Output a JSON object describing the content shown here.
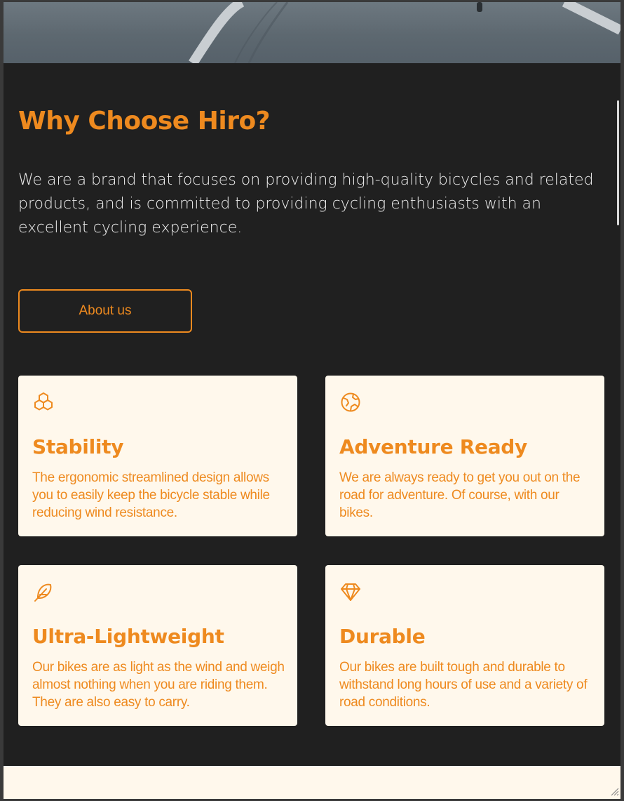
{
  "hero": {
    "image": "road-cyclist-photo"
  },
  "section": {
    "heading": "Why Choose Hiro?",
    "intro": "We are a brand that focuses on providing high-quality bicycles and related products, and is committed to providing cycling enthusiasts with an excellent cycling experience.",
    "cta_label": "About us"
  },
  "features": [
    {
      "icon": "cubes-icon",
      "title": "Stability",
      "description": "The ergonomic streamlined design allows you to easily keep the bicycle stable while reducing wind resistance."
    },
    {
      "icon": "globe-icon",
      "title": "Adventure Ready",
      "description": "We are always ready to get you out on the road for adventure. Of course, with our bikes."
    },
    {
      "icon": "feather-icon",
      "title": "Ultra-Lightweight",
      "description": "Our bikes are as light as the wind and weigh almost nothing when you are riding them. They are also easy to carry."
    },
    {
      "icon": "diamond-icon",
      "title": "Durable",
      "description": "Our bikes are built tough and durable to withstand long hours of use and a variety of road conditions."
    }
  ],
  "colors": {
    "accent": "#ee8a1f",
    "background": "#202020",
    "card": "#fff8ec",
    "text": "#eeeeee"
  }
}
